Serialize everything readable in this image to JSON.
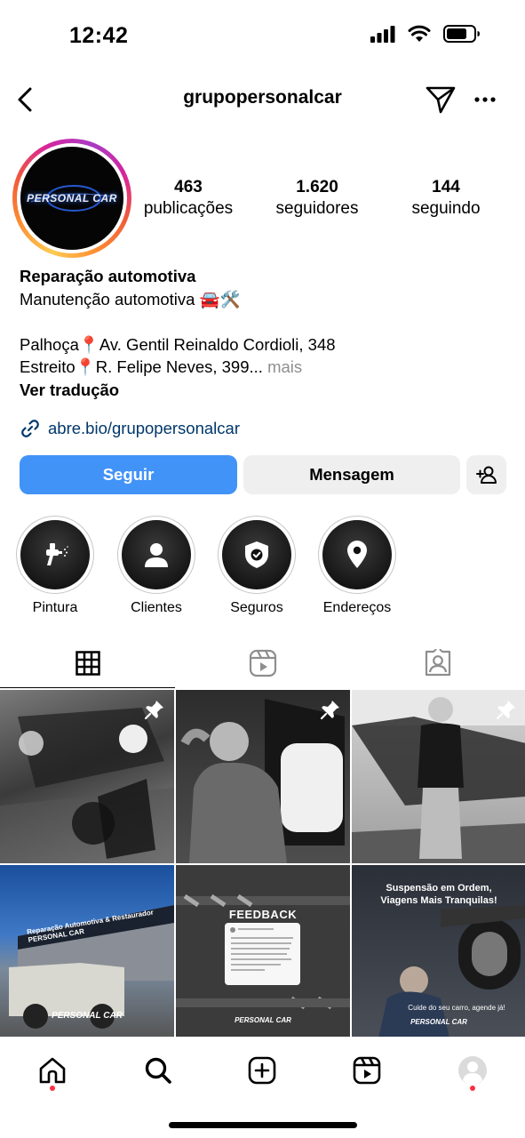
{
  "status_bar": {
    "time": "12:42"
  },
  "header": {
    "username": "grupopersonalcar"
  },
  "profile": {
    "avatar_logo_text": "PERSONAL CAR",
    "stats": [
      {
        "value": "463",
        "label": "publicações"
      },
      {
        "value": "1.620",
        "label": "seguidores"
      },
      {
        "value": "144",
        "label": "seguindo"
      }
    ]
  },
  "bio": {
    "category": "Reparação automotiva",
    "line1": "Manutenção automotiva 🚘🛠️",
    "line2": "Palhoça📍Av. Gentil Reinaldo Cordioli, 348",
    "line3": "Estreito📍R. Felipe Neves, 399...",
    "more": "mais",
    "translate": "Ver tradução",
    "link": "abre.bio/grupopersonalcar"
  },
  "actions": {
    "follow": "Seguir",
    "message": "Mensagem"
  },
  "highlights": [
    {
      "label": "Pintura",
      "icon": "spray-gun-icon"
    },
    {
      "label": "Clientes",
      "icon": "person-icon"
    },
    {
      "label": "Seguros",
      "icon": "shield-check-icon"
    },
    {
      "label": "Endereços",
      "icon": "location-pin-icon"
    }
  ],
  "tabs": [
    {
      "name": "posts",
      "icon": "grid-icon"
    },
    {
      "name": "reels",
      "icon": "reels-icon"
    },
    {
      "name": "tagged",
      "icon": "tagged-icon"
    }
  ],
  "posts": {
    "feedback_title": "FEEDBACK",
    "feedback_brand": "PERSONAL CAR",
    "storefront_sign": "Reparação Automotiva & Restaurador PERSONAL CAR",
    "truck_brand": "PERSONAL CAR",
    "suspension_headline_1": "Suspensão em Ordem,",
    "suspension_headline_2": "Viagens Mais Tranquilas!",
    "suspension_caption": "Cuide do seu carro, agende já!",
    "suspension_brand": "PERSONAL CAR"
  },
  "colors": {
    "follow_button": "#4293f7",
    "secondary_button": "#efefef",
    "link": "#00376b",
    "notification_dot": "#ff3040"
  }
}
